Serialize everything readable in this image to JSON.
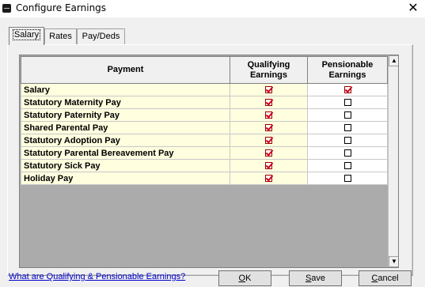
{
  "window": {
    "title": "Configure Earnings",
    "close_glyph": "✕"
  },
  "tabs": [
    {
      "label": "Salary",
      "active": true
    },
    {
      "label": "Rates",
      "active": false
    },
    {
      "label": "Pay/Deds",
      "active": false
    }
  ],
  "grid": {
    "headers": {
      "payment": "Payment",
      "qualifying": "Qualifying Earnings",
      "pensionable": "Pensionable Earnings"
    },
    "rows": [
      {
        "payment": "Salary",
        "qualifying": true,
        "pensionable": true
      },
      {
        "payment": "Statutory Maternity Pay",
        "qualifying": true,
        "pensionable": false
      },
      {
        "payment": "Statutory Paternity Pay",
        "qualifying": true,
        "pensionable": false
      },
      {
        "payment": "Shared Parental Pay",
        "qualifying": true,
        "pensionable": false
      },
      {
        "payment": "Statutory Adoption Pay",
        "qualifying": true,
        "pensionable": false
      },
      {
        "payment": "Statutory Parental Bereavement Pay",
        "qualifying": true,
        "pensionable": false
      },
      {
        "payment": "Statutory Sick Pay",
        "qualifying": true,
        "pensionable": false
      },
      {
        "payment": "Holiday Pay",
        "qualifying": true,
        "pensionable": false
      }
    ],
    "scroll_up_glyph": "▲",
    "scroll_down_glyph": "▼"
  },
  "footer": {
    "help_link": "What are Qualifying & Pensionable Earnings?",
    "ok_mnemonic": "O",
    "ok_rest": "K",
    "save_mnemonic": "S",
    "save_rest": "ave",
    "cancel_mnemonic": "C",
    "cancel_rest": "ancel"
  },
  "colors": {
    "cell_bg": "#fffedf",
    "grid_empty_bg": "#ababab",
    "check_mark": "#d0021b",
    "link": "#0000cc"
  },
  "icons": {
    "app": "app-icon",
    "close": "close-icon",
    "checkbox": "checkbox-icon"
  }
}
